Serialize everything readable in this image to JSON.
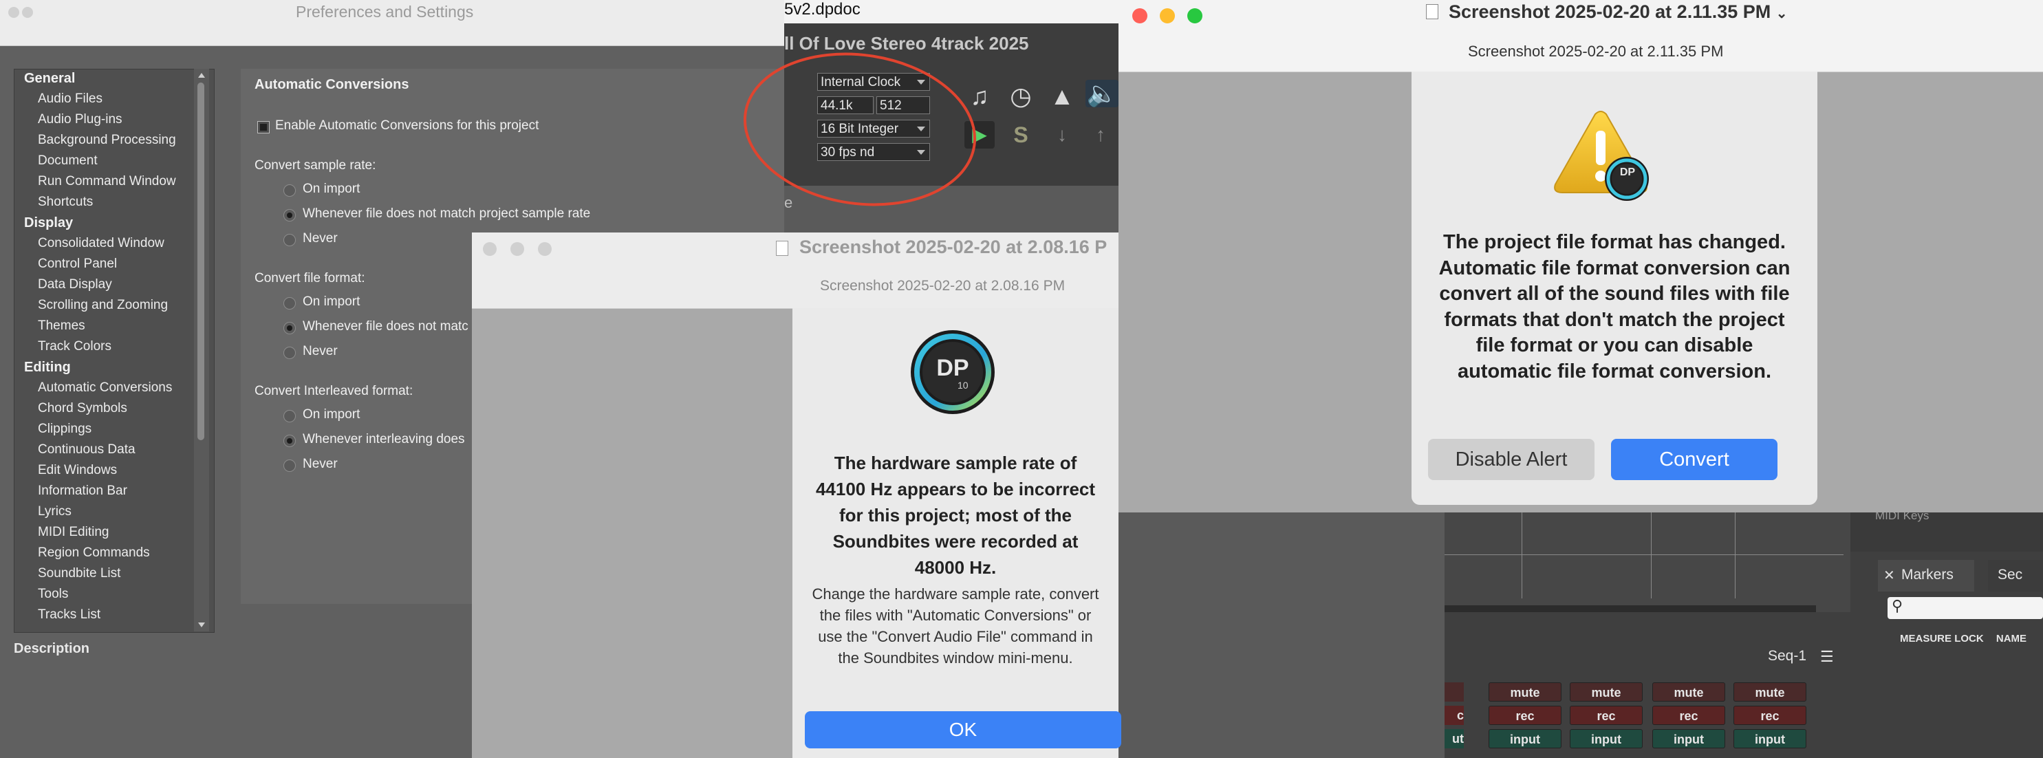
{
  "prefs": {
    "title": "Preferences and Settings",
    "categories": [
      {
        "label": "General",
        "head": true
      },
      {
        "label": "Audio Files"
      },
      {
        "label": "Audio Plug-ins"
      },
      {
        "label": "Background Processing"
      },
      {
        "label": "Document"
      },
      {
        "label": "Run Command Window"
      },
      {
        "label": "Shortcuts"
      },
      {
        "label": "Display",
        "head": true
      },
      {
        "label": "Consolidated Window"
      },
      {
        "label": "Control Panel"
      },
      {
        "label": "Data Display"
      },
      {
        "label": "Scrolling and Zooming"
      },
      {
        "label": "Themes"
      },
      {
        "label": "Track Colors"
      },
      {
        "label": "Editing",
        "head": true
      },
      {
        "label": "Automatic Conversions"
      },
      {
        "label": "Chord Symbols"
      },
      {
        "label": "Clippings"
      },
      {
        "label": "Continuous Data"
      },
      {
        "label": "Edit Windows"
      },
      {
        "label": "Information Bar"
      },
      {
        "label": "Lyrics"
      },
      {
        "label": "MIDI Editing"
      },
      {
        "label": "Region Commands"
      },
      {
        "label": "Soundbite List"
      },
      {
        "label": "Tools"
      },
      {
        "label": "Tracks List"
      }
    ],
    "description_label": "Description",
    "panel": {
      "heading": "Automatic Conversions",
      "enable_label": "Enable Automatic Conversions for this project",
      "sample_rate_label": "Convert sample rate:",
      "sample_rate_options": [
        "On import",
        "Whenever file does not match project sample rate",
        "Never"
      ],
      "file_format_label": "Convert file format:",
      "file_format_options": [
        "On import",
        "Whenever file does not matc",
        "Never"
      ],
      "interleaved_label": "Convert Interleaved format:",
      "interleaved_options": [
        "On import",
        "Whenever interleaving does",
        "Never"
      ]
    }
  },
  "dp": {
    "filename": "5v2.dpdoc",
    "track_title": "ll Of Love Stereo 4track 2025",
    "clock": "Internal Clock",
    "sample_rate": "44.1k",
    "buffer": "512",
    "bit_depth": "16 Bit Integer",
    "fps": "30 fps nd",
    "side_letter": "e"
  },
  "alert1": {
    "window_title": "Screenshot 2025-02-20 at 2.08.16 P",
    "subtitle": "Screenshot 2025-02-20 at 2.08.16 PM",
    "logo_text": "DP",
    "logo_num": "10",
    "message": "The hardware sample rate of 44100 Hz appears to be incorrect for this project; most of the Soundbites were recorded at 48000 Hz.",
    "detail": "Change the hardware sample rate, convert the files with \"Automatic Conversions\" or use the \"Convert Audio File\" command in the Soundbites window mini-menu.",
    "ok_label": "OK"
  },
  "alert2": {
    "window_title": "Screenshot 2025-02-20 at 2.11.35 PM",
    "subtitle": "Screenshot 2025-02-20 at 2.11.35 PM",
    "message": "The project file format has changed. Automatic file format conversion can convert all of the sound files with file formats that don't match the project file format or you can disable automatic file format conversion.",
    "disable_label": "Disable Alert",
    "convert_label": "Convert"
  },
  "dpwin2": {
    "midi_keys": "MIDI Keys",
    "markers_tab": "Markers",
    "sec_tab": "Sec",
    "col_measure": "MEASURE",
    "col_lock": "LOCK",
    "col_name": "NAME",
    "seq_label": "Seq-1",
    "mute": "mute",
    "rec": "rec",
    "input": "input",
    "rec_partial": "c",
    "input_partial": "ut"
  },
  "colors": {
    "accent_blue": "#3b82f6",
    "annotation_red": "#e0442f",
    "close_red": "#ff5f57",
    "min_yellow": "#febc2e",
    "max_green": "#28c840"
  }
}
